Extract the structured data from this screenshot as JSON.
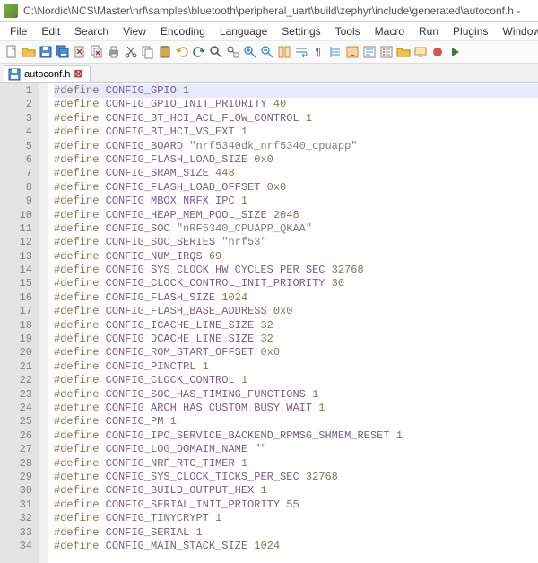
{
  "titlebar": {
    "path": "C:\\Nordic\\NCS\\Master\\nrf\\samples\\bluetooth\\peripheral_uart\\build\\zephyr\\include\\generated\\autoconf.h  -"
  },
  "menu": {
    "items": [
      "File",
      "Edit",
      "Search",
      "View",
      "Encoding",
      "Language",
      "Settings",
      "Tools",
      "Macro",
      "Run",
      "Plugins",
      "Window",
      "?"
    ]
  },
  "tab": {
    "label": "autoconf.h"
  },
  "code": {
    "lines": [
      {
        "n": 1,
        "d": "#define",
        "i": "CONFIG_GPIO",
        "v": "1"
      },
      {
        "n": 2,
        "d": "#define",
        "i": "CONFIG_GPIO_INIT_PRIORITY",
        "v": "40"
      },
      {
        "n": 3,
        "d": "#define",
        "i": "CONFIG_BT_HCI_ACL_FLOW_CONTROL",
        "v": "1"
      },
      {
        "n": 4,
        "d": "#define",
        "i": "CONFIG_BT_HCI_VS_EXT",
        "v": "1"
      },
      {
        "n": 5,
        "d": "#define",
        "i": "CONFIG_BOARD",
        "v": "\"nrf5340dk_nrf5340_cpuapp\"",
        "s": true
      },
      {
        "n": 6,
        "d": "#define",
        "i": "CONFIG_FLASH_LOAD_SIZE",
        "v": "0x0"
      },
      {
        "n": 7,
        "d": "#define",
        "i": "CONFIG_SRAM_SIZE",
        "v": "448"
      },
      {
        "n": 8,
        "d": "#define",
        "i": "CONFIG_FLASH_LOAD_OFFSET",
        "v": "0x0"
      },
      {
        "n": 9,
        "d": "#define",
        "i": "CONFIG_MBOX_NRFX_IPC",
        "v": "1"
      },
      {
        "n": 10,
        "d": "#define",
        "i": "CONFIG_HEAP_MEM_POOL_SIZE",
        "v": "2048"
      },
      {
        "n": 11,
        "d": "#define",
        "i": "CONFIG_SOC",
        "v": "\"nRF5340_CPUAPP_QKAA\"",
        "s": true
      },
      {
        "n": 12,
        "d": "#define",
        "i": "CONFIG_SOC_SERIES",
        "v": "\"nrf53\"",
        "s": true
      },
      {
        "n": 13,
        "d": "#define",
        "i": "CONFIG_NUM_IRQS",
        "v": "69"
      },
      {
        "n": 14,
        "d": "#define",
        "i": "CONFIG_SYS_CLOCK_HW_CYCLES_PER_SEC",
        "v": "32768"
      },
      {
        "n": 15,
        "d": "#define",
        "i": "CONFIG_CLOCK_CONTROL_INIT_PRIORITY",
        "v": "30"
      },
      {
        "n": 16,
        "d": "#define",
        "i": "CONFIG_FLASH_SIZE",
        "v": "1024"
      },
      {
        "n": 17,
        "d": "#define",
        "i": "CONFIG_FLASH_BASE_ADDRESS",
        "v": "0x0"
      },
      {
        "n": 18,
        "d": "#define",
        "i": "CONFIG_ICACHE_LINE_SIZE",
        "v": "32"
      },
      {
        "n": 19,
        "d": "#define",
        "i": "CONFIG_DCACHE_LINE_SIZE",
        "v": "32"
      },
      {
        "n": 20,
        "d": "#define",
        "i": "CONFIG_ROM_START_OFFSET",
        "v": "0x0"
      },
      {
        "n": 21,
        "d": "#define",
        "i": "CONFIG_PINCTRL",
        "v": "1"
      },
      {
        "n": 22,
        "d": "#define",
        "i": "CONFIG_CLOCK_CONTROL",
        "v": "1"
      },
      {
        "n": 23,
        "d": "#define",
        "i": "CONFIG_SOC_HAS_TIMING_FUNCTIONS",
        "v": "1"
      },
      {
        "n": 24,
        "d": "#define",
        "i": "CONFIG_ARCH_HAS_CUSTOM_BUSY_WAIT",
        "v": "1"
      },
      {
        "n": 25,
        "d": "#define",
        "i": "CONFIG_PM",
        "v": "1"
      },
      {
        "n": 26,
        "d": "#define",
        "i": "CONFIG_IPC_SERVICE_BACKEND_RPMSG_SHMEM_RESET",
        "v": "1"
      },
      {
        "n": 27,
        "d": "#define",
        "i": "CONFIG_LOG_DOMAIN_NAME",
        "v": "\"\"",
        "s": true
      },
      {
        "n": 28,
        "d": "#define",
        "i": "CONFIG_NRF_RTC_TIMER",
        "v": "1"
      },
      {
        "n": 29,
        "d": "#define",
        "i": "CONFIG_SYS_CLOCK_TICKS_PER_SEC",
        "v": "32768"
      },
      {
        "n": 30,
        "d": "#define",
        "i": "CONFIG_BUILD_OUTPUT_HEX",
        "v": "1"
      },
      {
        "n": 31,
        "d": "#define",
        "i": "CONFIG_SERIAL_INIT_PRIORITY",
        "v": "55"
      },
      {
        "n": 32,
        "d": "#define",
        "i": "CONFIG_TINYCRYPT",
        "v": "1"
      },
      {
        "n": 33,
        "d": "#define",
        "i": "CONFIG_SERIAL",
        "v": "1"
      },
      {
        "n": 34,
        "d": "#define",
        "i": "CONFIG_MAIN_STACK_SIZE",
        "v": "1024"
      }
    ]
  }
}
